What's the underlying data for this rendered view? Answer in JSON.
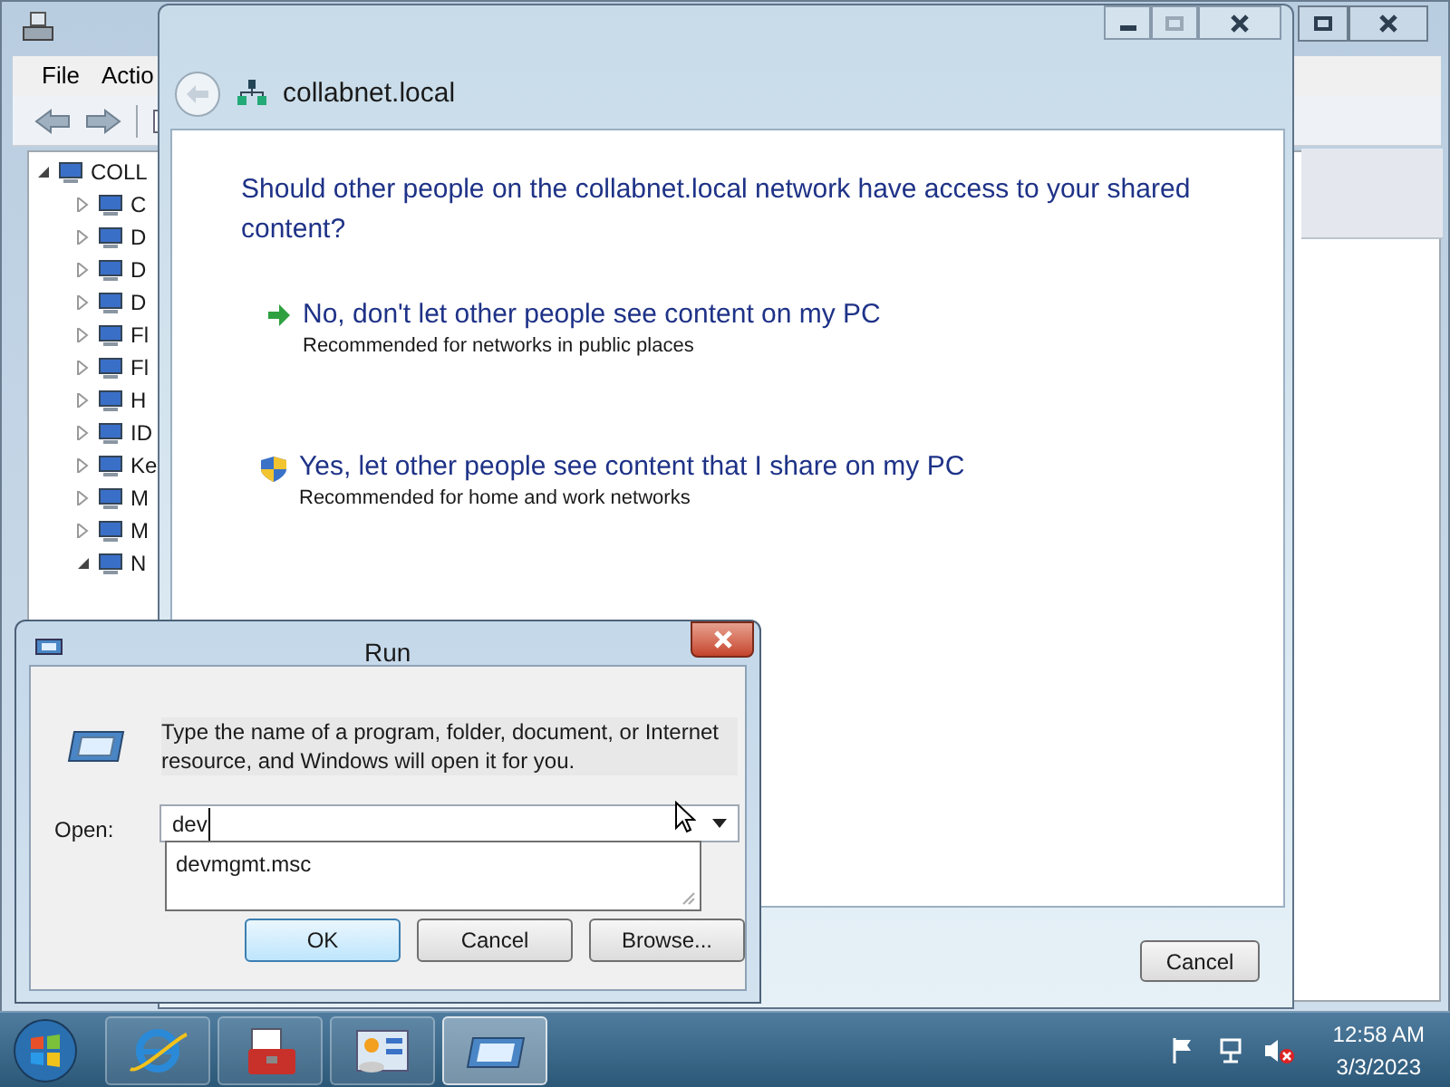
{
  "device_manager": {
    "menu": [
      "File",
      "Actio"
    ],
    "tree": [
      {
        "label": "COLL",
        "expanded": true,
        "children": [
          {
            "label": "C",
            "expanded": false
          },
          {
            "label": "D",
            "expanded": false
          },
          {
            "label": "D",
            "expanded": false
          },
          {
            "label": "D",
            "expanded": false
          },
          {
            "label": "Fl",
            "expanded": false
          },
          {
            "label": "Fl",
            "expanded": false
          },
          {
            "label": "H",
            "expanded": false
          },
          {
            "label": "ID",
            "expanded": false
          },
          {
            "label": "Ke",
            "expanded": false
          },
          {
            "label": "M",
            "expanded": false
          },
          {
            "label": "M",
            "expanded": false
          },
          {
            "label": "N",
            "expanded": true
          }
        ]
      }
    ]
  },
  "network_dialog": {
    "location": "collabnet.local",
    "question": "Should other people on the collabnet.local network have access to your shared content?",
    "options": [
      {
        "kind": "arrow",
        "title": "No, don't let other people see content on my PC",
        "subtitle": "Recommended for networks in public places"
      },
      {
        "kind": "shield",
        "title": "Yes, let other people see content that I share on my PC",
        "subtitle": "Recommended for home and work networks"
      }
    ],
    "buttons": [
      "Cancel"
    ]
  },
  "run_dialog": {
    "title": "Run",
    "description": "Type the name of a program, folder, document, or Internet resource, and Windows will open it for you.",
    "open_label": "Open:",
    "value": "dev",
    "suggestions": [
      "devmgmt.msc"
    ],
    "buttons": [
      {
        "label": "OK",
        "default": true
      },
      {
        "label": "Cancel",
        "default": false
      },
      {
        "label": "Browse...",
        "default": false
      }
    ]
  },
  "taskbar": {
    "apps": [
      {
        "kind": "browser",
        "active": false
      },
      {
        "kind": "toolbox",
        "active": false
      },
      {
        "kind": "panel",
        "active": false
      },
      {
        "kind": "run",
        "active": true
      }
    ],
    "time": "12:58 AM",
    "date": "3/3/2023"
  }
}
